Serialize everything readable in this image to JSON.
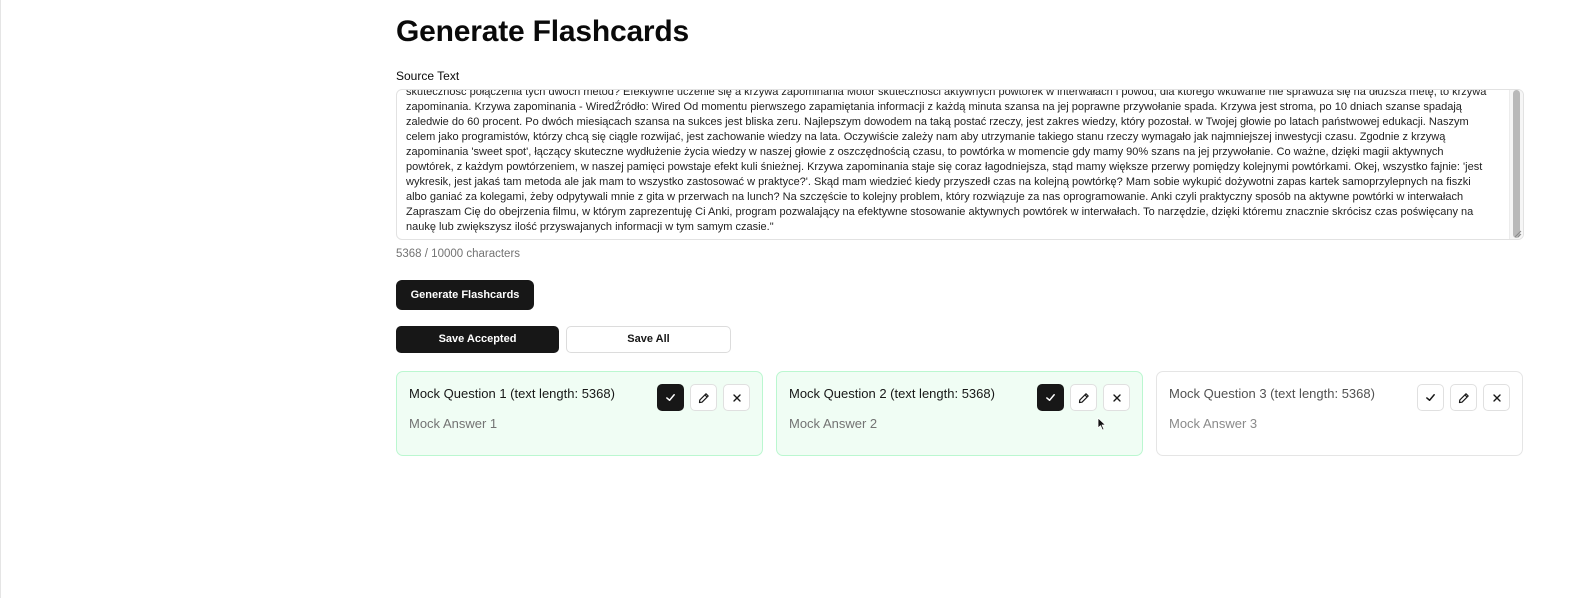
{
  "page": {
    "title": "Generate Flashcards"
  },
  "source": {
    "label": "Source Text",
    "text": "skuteczność połączenia tych dwóch metod? Efektywne uczenie się a krzywa zapominania Motor skuteczności aktywnych powtórek w interwałach i powód, dla którego wkuwanie nie sprawdza się na dłuższa metę, to krzywa zapominania. Krzywa zapominania - WiredŹródło: Wired Od momentu pierwszego zapamiętania informacji z każdą minuta szansa na jej poprawne przywołanie spada. Krzywa jest stroma, po 10 dniach szanse spadają zaledwie do 60 procent. Po dwóch miesiącach szansa na sukces jest bliska zeru. Najlepszym dowodem na taką postać rzeczy, jest zakres wiedzy, który pozostał. w Twojej głowie po latach państwowej edukacji. Naszym celem jako programistów, którzy chcą się ciągle rozwijać, jest zachowanie wiedzy na lata. Oczywiście zależy nam aby utrzymanie takiego stanu rzeczy wymagało jak najmniejszej inwestycji czasu. Zgodnie z krzywą zapominania 'sweet spot', łączący skuteczne wydłużenie życia wiedzy w naszej głowie z oszczędnością czasu, to powtórka w momencie gdy mamy 90% szans na jej przywołanie. Co ważne, dzięki magii aktywnych powtórek, z każdym powtórzeniem, w naszej pamięci powstaje efekt kuli śnieżnej. Krzywa zapominania staje się coraz łagodniejsza, stąd mamy większe przerwy pomiędzy kolejnymi powtórkami. Okej, wszystko fajnie: 'jest wykresik, jest jakaś tam metoda ale jak mam to wszystko zastosować w praktyce?'. Skąd mam wiedzieć kiedy przyszedł czas na kolejną powtórkę? Mam sobie wykupić dożywotni zapas kartek samoprzylepnych na fiszki albo ganiać za kolegami, żeby odpytywali mnie z gita w przerwach na lunch? Na szczęście to kolejny problem, który rozwiązuje za nas oprogramowanie. Anki czyli praktyczny sposób na aktywne powtórki w interwałach Zapraszam Cię do obejrzenia filmu, w którym zaprezentuję Ci Anki, program pozwalający na efektywne stosowanie aktywnych powtórek w interwałach. To narzędzie, dzięki któremu znacznie skrócisz czas poświęcany na naukę lub zwiększysz ilość przyswajanych informacji w tym samym czasie.\"",
    "char_count": "5368 / 10000 characters",
    "scroll_position": 0.62
  },
  "buttons": {
    "generate": "Generate Flashcards",
    "save_accepted": "Save Accepted",
    "save_all": "Save All"
  },
  "flashcards": [
    {
      "question": "Mock Question 1 (text length: 5368)",
      "answer": "Mock Answer 1",
      "status": "accepted"
    },
    {
      "question": "Mock Question 2 (text length: 5368)",
      "answer": "Mock Answer 2",
      "status": "accepted"
    },
    {
      "question": "Mock Question 3 (text length: 5368)",
      "answer": "Mock Answer 3",
      "status": "pending"
    }
  ],
  "icons": {
    "accept": "check-icon",
    "edit": "pencil-icon",
    "reject": "close-icon"
  },
  "colors": {
    "primary": "#171717",
    "accepted_bg": "#f0fdf4",
    "accepted_border": "#bbf7d0",
    "muted_text": "#737373"
  }
}
